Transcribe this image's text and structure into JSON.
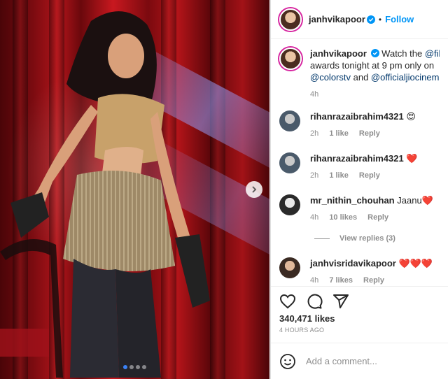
{
  "post": {
    "username": "janhvikapoor",
    "follow_label": "Follow",
    "dot": "•",
    "caption": {
      "text_1": "Watch the ",
      "mention_1": "@filmfa",
      "text_2": "awards tonight at 9 pm only on",
      "mention_2": "@colorstv",
      "text_3": " and ",
      "mention_3": "@officialjiocinema",
      "time": "4h"
    },
    "comments": [
      {
        "username": "rihanrazaibrahim4321",
        "text": "😍",
        "time": "2h",
        "likes": "1 like",
        "reply": "Reply"
      },
      {
        "username": "rihanrazaibrahim4321",
        "text": "❤️",
        "time": "2h",
        "likes": "1 like",
        "reply": "Reply"
      },
      {
        "username": "mr_nithin_chouhan",
        "text": "Jaanu❤️",
        "time": "4h",
        "likes": "10 likes",
        "reply": "Reply",
        "view_replies": "View replies (3)"
      },
      {
        "username": "janhvisridavikapoor",
        "text": "❤️❤️❤️",
        "time": "4h",
        "likes": "7 likes",
        "reply": "Reply"
      }
    ],
    "likes_count": "340,471 likes",
    "time_ago": "4 HOURS AGO",
    "add_comment_placeholder": "Add a comment..."
  },
  "colors": {
    "link": "#0095f6",
    "mention": "#00376b",
    "verified": "#0095f6",
    "meta": "#8e8e8e"
  },
  "media": {
    "carousel_total": 4,
    "carousel_active": 1
  }
}
